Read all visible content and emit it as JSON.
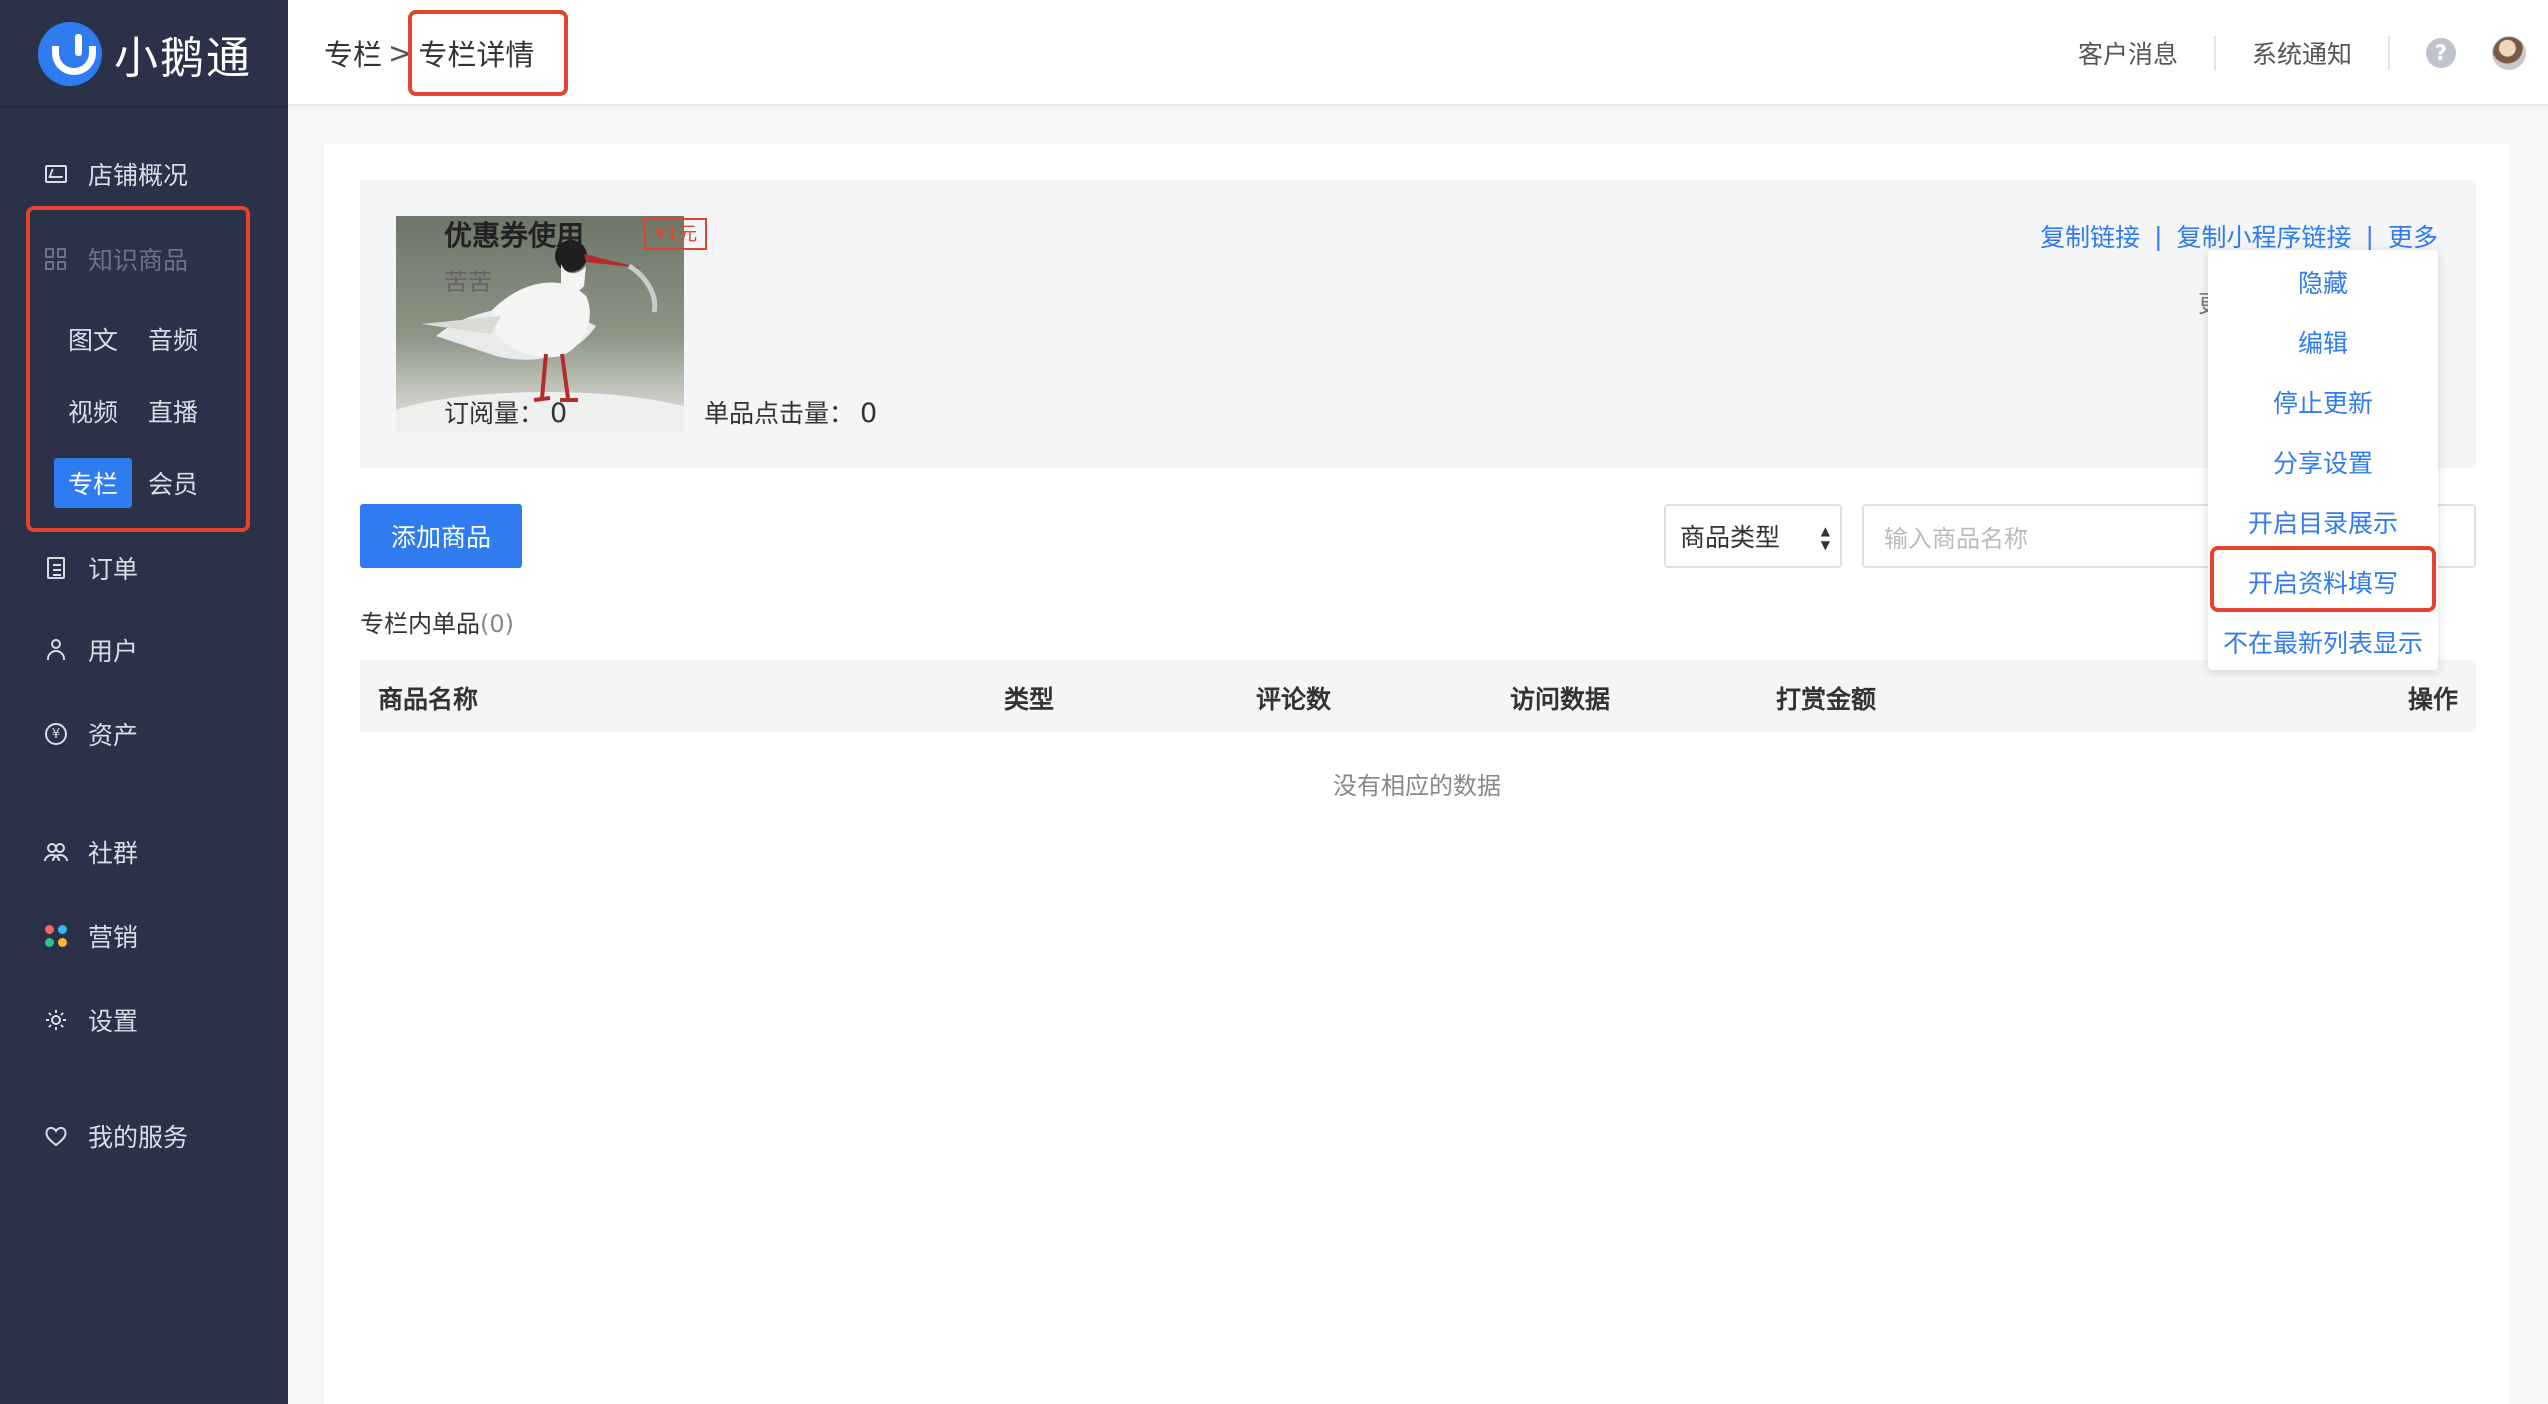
{
  "brand": {
    "name": "小鹅通"
  },
  "sidebar": {
    "items": [
      {
        "label": "店铺概况"
      },
      {
        "label": "知识商品"
      },
      {
        "label": "订单"
      },
      {
        "label": "用户"
      },
      {
        "label": "资产"
      },
      {
        "label": "社群"
      },
      {
        "label": "营销"
      },
      {
        "label": "设置"
      },
      {
        "label": "我的服务"
      }
    ],
    "sub_items": [
      {
        "label": "图文"
      },
      {
        "label": "音频"
      },
      {
        "label": "视频"
      },
      {
        "label": "直播"
      },
      {
        "label": "专栏",
        "active": true
      },
      {
        "label": "会员"
      }
    ],
    "asset_icon_glyph": "¥"
  },
  "header": {
    "breadcrumb": {
      "parent": "专栏",
      "separator": ">",
      "current": "专栏详情"
    },
    "links": [
      "客户消息",
      "系统通知"
    ],
    "help_glyph": "?"
  },
  "product": {
    "title": "优惠券使用",
    "price_badge": "¥1元",
    "author": "苦苦",
    "stats": [
      {
        "label": "订阅量：",
        "value": "0"
      },
      {
        "label": "单品点击量：",
        "value": "0"
      }
    ],
    "actions": {
      "copy_link": "复制链接",
      "copy_mini_link": "复制小程序链接",
      "more": "更多",
      "divider": "|"
    },
    "peek_text": "更"
  },
  "toolbar": {
    "add_button": "添加商品",
    "type_select": "商品类型",
    "search_placeholder": "输入商品名称"
  },
  "list": {
    "title": "专栏内单品",
    "count": "(0)",
    "columns": [
      "商品名称",
      "类型",
      "评论数",
      "访问数据",
      "打赏金额",
      "操作"
    ],
    "empty_text": "没有相应的数据"
  },
  "more_menu": {
    "items": [
      "隐藏",
      "编辑",
      "停止更新",
      "分享设置",
      "开启目录展示",
      "开启资料填写",
      "不在最新列表显示"
    ]
  },
  "colors": {
    "sidebar_bg": "#2a3148",
    "accent": "#2f7bf0",
    "highlight": "#e5432d"
  }
}
